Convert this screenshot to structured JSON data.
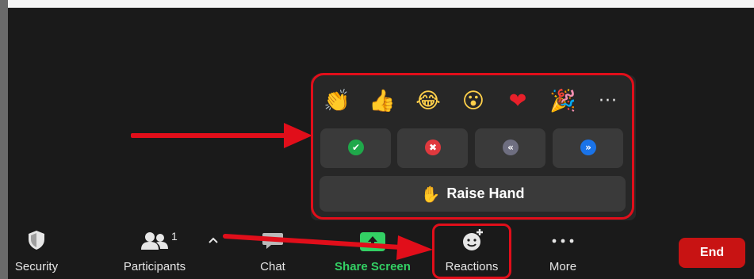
{
  "reactions_popup": {
    "emojis": [
      "👏",
      "👍",
      "😂",
      "😮",
      "❤",
      "🎉"
    ],
    "more_glyph": "···",
    "feedback_glyphs": [
      "✔",
      "✖",
      "«",
      "»"
    ],
    "feedback_colors": [
      "#1fa84a",
      "#e0393e",
      "#6e6e80",
      "#1a73e8"
    ],
    "raise_hand": {
      "icon": "✋",
      "label": "Raise Hand"
    }
  },
  "toolbar": {
    "security": "Security",
    "participants": "Participants",
    "participants_count": "1",
    "chat": "Chat",
    "share_screen": "Share Screen",
    "reactions": "Reactions",
    "more": "More",
    "end": "End"
  },
  "icons": {
    "security": "shield-icon",
    "participants": "people-icon",
    "chat": "chat-bubble-icon",
    "share_screen": "share-screen-icon",
    "reactions": "smile-plus-icon",
    "more": "more-dots-icon",
    "caret": "chevron-up-icon"
  },
  "colors": {
    "annotation_red": "#e10e1a",
    "end_red": "#c81313",
    "share_green": "#33d064"
  }
}
